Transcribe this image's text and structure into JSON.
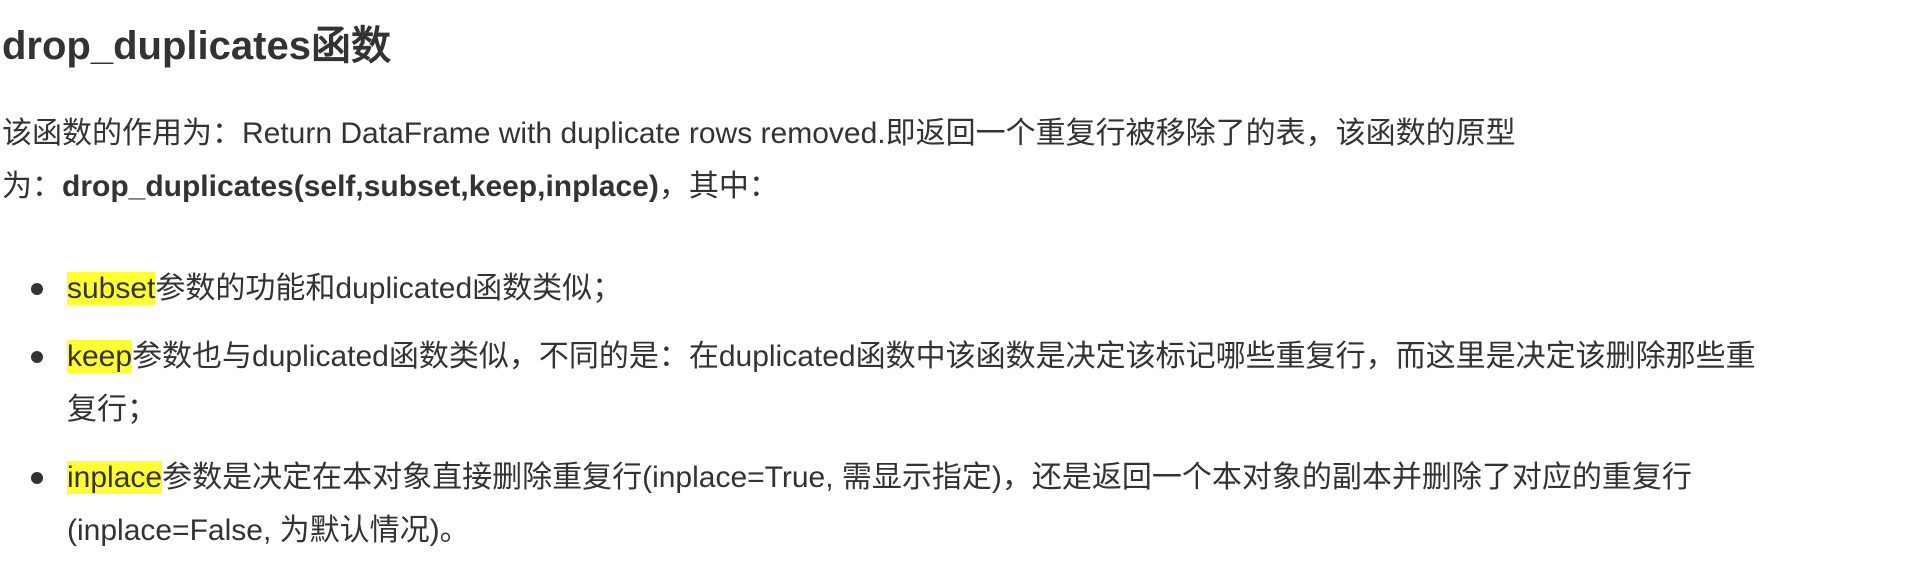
{
  "title": "drop_duplicates函数",
  "intro": {
    "line1": "该函数的作用为：Return DataFrame with duplicate rows removed.即返回一个重复行被移除了的表，该函数的原型",
    "line2_prefix": "为：",
    "signature": "drop_duplicates(self,subset,keep,inplace)",
    "line2_suffix": "，其中："
  },
  "params": [
    {
      "name": "subset",
      "line1": "参数的功能和duplicated函数类似；",
      "line2": ""
    },
    {
      "name": "keep",
      "line1": "参数也与duplicated函数类似，不同的是：在duplicated函数中该函数是决定该标记哪些重复行，而这里是决定该删除那些重",
      "line2": "复行；"
    },
    {
      "name": "inplace",
      "line1": "参数是决定在本对象直接删除重复行(inplace=True, 需显示指定)，还是返回一个本对象的副本并删除了对应的重复行",
      "line2": "(inplace=False, 为默认情况)。"
    }
  ],
  "colors": {
    "text": "#333333",
    "highlight": "#ffff33",
    "background": "#ffffff"
  }
}
